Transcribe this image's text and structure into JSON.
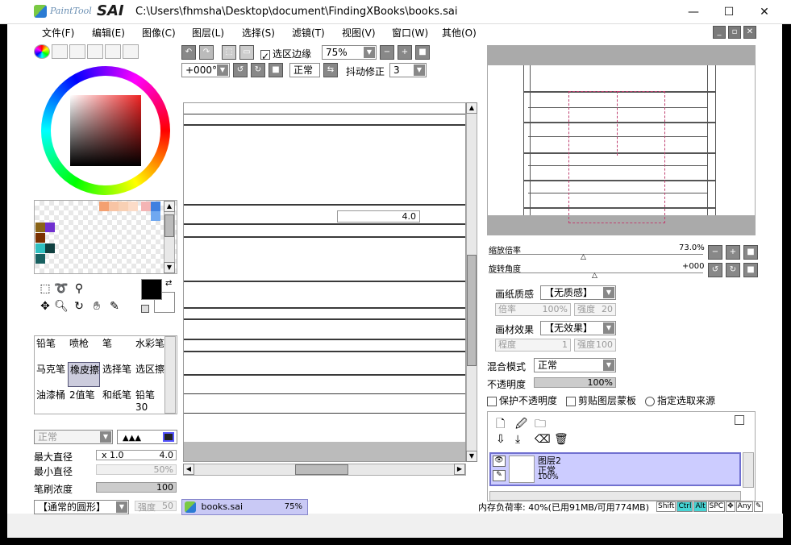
{
  "window": {
    "app_logo_text": "PaintTool",
    "app_logo_brand": "SAI",
    "title": "C:\\Users\\fhmsha\\Desktop\\document\\FindingXBooks\\books.sai",
    "minimize": "—",
    "maximize": "☐",
    "close": "✕"
  },
  "menu": {
    "items": [
      "文件(F)",
      "编辑(E)",
      "图像(C)",
      "图层(L)",
      "选择(S)",
      "滤镜(T)",
      "视图(V)",
      "窗口(W)",
      "其他(O)"
    ]
  },
  "toolbar": {
    "selection_edge_label": "选区边缘",
    "zoom_value": "75%",
    "rotation_value": "+000°",
    "mode_value": "正常",
    "stabilizer_label": "抖动修正",
    "stabilizer_value": "3"
  },
  "brushes": {
    "items": [
      "铅笔",
      "喷枪",
      "笔",
      "水彩笔",
      "马克笔",
      "橡皮擦",
      "选择笔",
      "选区擦",
      "油漆桶",
      "2值笔",
      "和纸笔",
      "铅笔30"
    ],
    "selected": "橡皮擦"
  },
  "brush_settings": {
    "blend_mode": "正常",
    "max_size_label": "最大直径",
    "max_size_multiplier": "x 1.0",
    "max_size_value": "4.0",
    "min_size_label": "最小直径",
    "min_size_value": "50%",
    "density_label": "笔刷浓度",
    "density_value": "100",
    "shape_value": "【通常的圆形】",
    "strength_label": "强度",
    "strength_value": "50"
  },
  "canvas": {
    "size_tooltip": "4.0",
    "file_tab_name": "books.sai",
    "file_tab_zoom": "75%"
  },
  "navigator": {
    "zoom_label": "缩放倍率",
    "zoom_value": "73.0%",
    "rotate_label": "旋转角度",
    "rotate_value": "+000"
  },
  "layer_props": {
    "paper_texture_label": "画纸质感",
    "paper_texture_value": "【无质感】",
    "scale_label": "倍率",
    "scale_value": "100%",
    "strength_label": "强度",
    "strength_value": "20",
    "paper_effect_label": "画材效果",
    "paper_effect_value": "【无效果】",
    "degree_label": "程度",
    "degree_value": "1",
    "effect_strength_label": "强度",
    "effect_strength_value": "100",
    "blend_label": "混合模式",
    "blend_value": "正常",
    "opacity_label": "不透明度",
    "opacity_value": "100%",
    "preserve_opacity": "保护不透明度",
    "clipping": "剪贴图层蒙板",
    "selection_source": "指定选取来源"
  },
  "layers": {
    "items": [
      {
        "name": "图层2",
        "mode": "正常",
        "opacity": "100%"
      }
    ]
  },
  "status": {
    "memory": "内存负荷率: 40%(已用91MB/可用774MB)",
    "keys": [
      "Shift",
      "Ctrl",
      "Alt",
      "SPC",
      "Any"
    ]
  }
}
